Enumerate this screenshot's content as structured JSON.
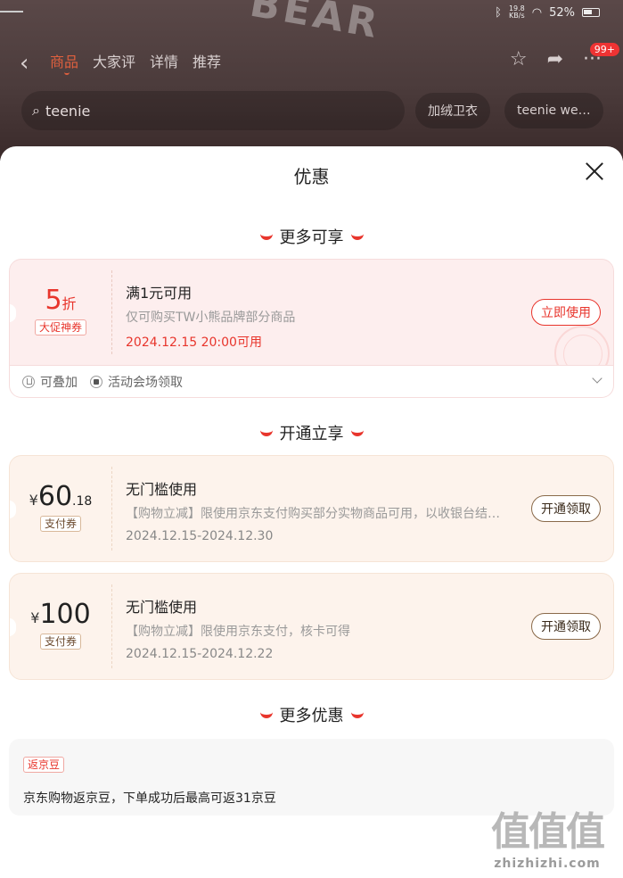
{
  "background": {
    "status": {
      "net_speed": "19.8",
      "net_unit": "KB/s",
      "battery": "52%"
    },
    "tabs": [
      "商品",
      "大家评",
      "详情",
      "推荐"
    ],
    "search_text": "teenie",
    "pills": [
      "加绒卫衣",
      "teenie we…"
    ],
    "cart_badge": "99+"
  },
  "sheet": {
    "title": "优惠",
    "sections": {
      "more_available": "更多可享",
      "open_enjoy": "开通立享",
      "more_offers": "更多优惠"
    },
    "coupon_main": {
      "amount": "5",
      "unit": "折",
      "tag": "大促神券",
      "title": "满1元可用",
      "desc": "仅可购买TW小熊品牌部分商品",
      "date": "2024.12.15 20:00可用",
      "button": "立即使用",
      "foot_stack": "可叠加",
      "foot_venue": "活动会场领取"
    },
    "coupon_pay1": {
      "currency": "¥",
      "amount": "60",
      "decimal": ".18",
      "tag": "支付券",
      "title": "无门槛使用",
      "desc": "【购物立减】限使用京东支付购买部分实物商品可用，以收银台结…",
      "date": "2024.12.15-2024.12.30",
      "button": "开通领取"
    },
    "coupon_pay2": {
      "currency": "¥",
      "amount": "100",
      "tag": "支付券",
      "title": "无门槛使用",
      "desc": "【购物立减】限使用京东支付，核卡可得",
      "date": "2024.12.15-2024.12.22",
      "button": "开通领取"
    },
    "more": {
      "tag": "返京豆",
      "text": "京东购物返京豆，下单成功后最高可返31京豆"
    }
  },
  "watermark": {
    "mark": "值值值",
    "url": "zhizhizhi.com"
  },
  "colors": {
    "accent": "#e8352c",
    "card_red": "#fdeeee",
    "card_cream": "#fdf3ec"
  }
}
